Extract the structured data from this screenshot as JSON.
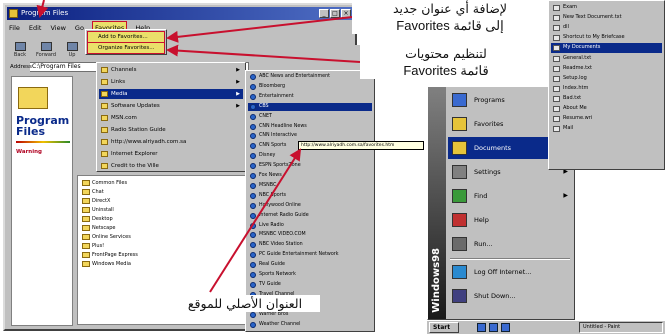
{
  "explorer": {
    "title": "Program Files",
    "menu": [
      "File",
      "Edit",
      "View",
      "Go",
      "Favorites",
      "Help"
    ],
    "address_label": "Address",
    "address_value": "C:\\Program Files",
    "toolbar": [
      "Back",
      "Forward",
      "Up",
      "Cut",
      "Copy",
      "Paste",
      "Undo",
      "Delete",
      "Properties"
    ],
    "left_pane": {
      "heading": "Program Files",
      "warning": "Warning"
    },
    "files": [
      "Common Files",
      "Chat",
      "DirectX",
      "Uninstall",
      "Desktop",
      "Netscape",
      "Online Services",
      "Plus!",
      "FrontPage Express",
      "Windows Media"
    ]
  },
  "favorites_menu": {
    "items": [
      "Add to Favorites...",
      "Organize Favorites..."
    ]
  },
  "favorites_list": {
    "items": [
      "Channels",
      "Links",
      "Media",
      "Software Updates",
      "MSN.com",
      "Radio Station Guide",
      "http://www.alriyadh.com.sa",
      "Internet Explorer",
      "Credit to the Ville"
    ],
    "highlight_index": 2
  },
  "links_list": {
    "items": [
      "ABC News and Entertainment",
      "Bloomberg",
      "Entertainment",
      "CBS",
      "CNET",
      "CNN Headline News",
      "CNN Interactive",
      "CNN Sports",
      "Disney",
      "ESPN SportsZone",
      "Fox News",
      "MSNBC",
      "NBC Sports",
      "Hollywood Online",
      "Internet Radio Guide",
      "Live Radio",
      "MSNBC VIDEO.COM",
      "NBC Video Station",
      "PC Guide Entertainment Network",
      "Real Guide",
      "Sports Network",
      "TV Guide",
      "Travel Channel",
      "USA Today",
      "Warner Bros",
      "Weather Channel"
    ],
    "highlight_index": 3,
    "tooltip": "http://www.alriyadh.com.sa/favorites.htm"
  },
  "start_menu": {
    "band_text": "Windows98",
    "items": [
      {
        "label": "Programs",
        "icon": "programs-icon",
        "arrow": true
      },
      {
        "label": "Favorites",
        "icon": "favorites-icon",
        "arrow": true
      },
      {
        "label": "Documents",
        "icon": "documents-icon",
        "arrow": true
      },
      {
        "label": "Settings",
        "icon": "settings-icon",
        "arrow": true
      },
      {
        "label": "Find",
        "icon": "find-icon",
        "arrow": true
      },
      {
        "label": "Help",
        "icon": "help-icon",
        "arrow": false
      },
      {
        "label": "Run...",
        "icon": "run-icon",
        "arrow": false
      },
      {
        "label": "Log Off Internet...",
        "icon": "logoff-icon",
        "arrow": false
      },
      {
        "label": "Shut Down...",
        "icon": "shutdown-icon",
        "arrow": false
      }
    ],
    "highlight_index": 2
  },
  "documents_list": {
    "items": [
      "Exam",
      "New Text Document.txt",
      "dll",
      "Shortcut to My Briefcase",
      "My Documents",
      "General.txt",
      "Readme.txt",
      "Setup.log",
      "Index.htm",
      "Bad.txt",
      "About Me",
      "Resume.wri",
      "Mail"
    ],
    "highlight_index": 4
  },
  "taskbar": {
    "start": "Start",
    "active_task": "Untitled - Paint"
  },
  "annotations": {
    "add": {
      "arabic": "لإضافة أي عنوان جديد",
      "arabic2": "إلى قائمة",
      "english": "Favorites"
    },
    "organize": {
      "arabic": "لتنظيم محتويات",
      "english": "Favorites",
      "arabic2": "قائمة"
    },
    "origin": {
      "arabic": "العنوان الأصلي للموقع"
    }
  },
  "colors": {
    "highlight": "#0a2a8a",
    "annotation_arrow": "#c8102e",
    "menu_mark": "#eae06a"
  }
}
